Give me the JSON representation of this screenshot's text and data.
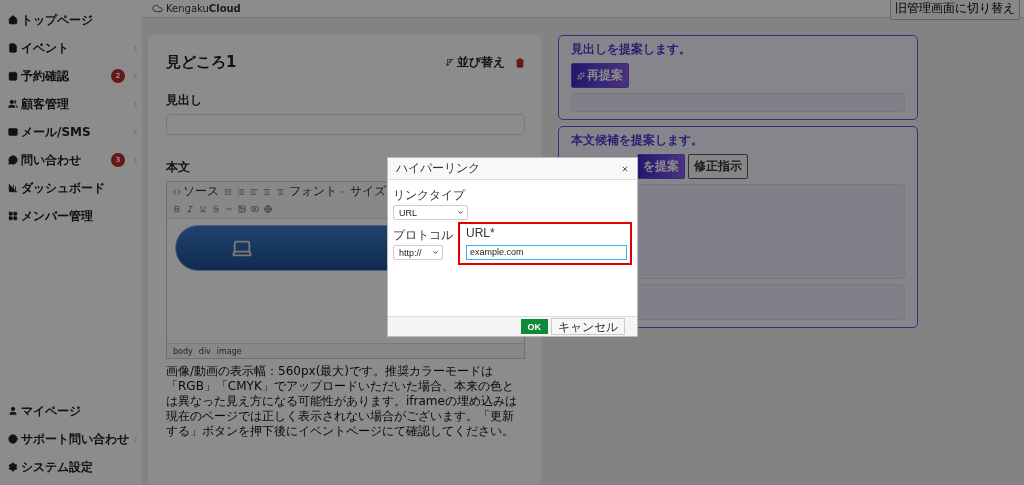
{
  "sidebar": {
    "items": [
      {
        "label": "トップページ",
        "submenu": false
      },
      {
        "label": "イベント",
        "submenu": true
      },
      {
        "label": "予約確認",
        "badge": "2",
        "submenu": true
      },
      {
        "label": "顧客管理",
        "submenu": true
      },
      {
        "label": "メール/SMS",
        "submenu": true
      },
      {
        "label": "問い合わせ",
        "badge": "3",
        "submenu": true
      },
      {
        "label": "ダッシュボード",
        "submenu": false
      },
      {
        "label": "メンバー管理",
        "submenu": false
      }
    ],
    "bottom_items": [
      {
        "label": "マイページ",
        "submenu": false
      },
      {
        "label": "サポート問い合わせ",
        "submenu": true
      },
      {
        "label": "システム設定",
        "submenu": false
      }
    ]
  },
  "header": {
    "logo": "Kengaku**Cloud**",
    "switch_button": "旧管理画面に切り替え"
  },
  "editor_card": {
    "title": "見どころ1",
    "sort_button": "並び替え",
    "heading_label": "見出し",
    "body_label": "本文",
    "toolbar": {
      "source": "ソース",
      "font": "フォント",
      "size": "サイズ"
    },
    "path": [
      "body",
      "div",
      "image"
    ],
    "note": "画像/動画の表示幅：560px(最大)です。推奨カラーモードは「RGB」「CMYK」でアップロードいただいた場合、本来の色とは異なった見え方になる可能性があります。iframeの埋め込みは現在のページでは正しく表示されない場合がございます。「更新する」ボタンを押下後にイベントページにて確認してください。"
  },
  "suggestions": [
    {
      "title": "見出しを提案します。",
      "buttons": [
        {
          "label": "再提案",
          "kind": "primary"
        }
      ]
    },
    {
      "title": "本文候補を提案します。",
      "buttons": [
        {
          "label": "を提案",
          "kind": "primary"
        },
        {
          "label": "修正指示",
          "kind": "outline"
        }
      ]
    }
  ],
  "dialog": {
    "title": "ハイパーリンク",
    "link_type_label": "リンクタイプ",
    "link_type": "URL",
    "protocol_label": "プロトコル",
    "protocol": "http://",
    "url_label": "URL*",
    "url_value": "example.com",
    "url_highlighted": true,
    "ok": "OK",
    "cancel": "キャンセル"
  }
}
